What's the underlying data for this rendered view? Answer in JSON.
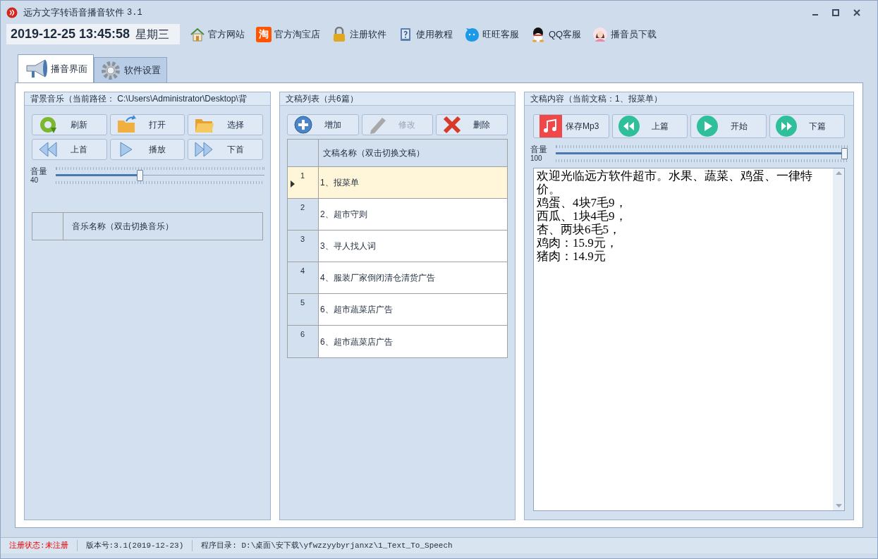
{
  "window": {
    "title": "远方文字转语音播音软件",
    "version": "3.1"
  },
  "toolbar": {
    "datetime": "2019-12-25 13:45:58",
    "weekday": "星期三",
    "links": [
      {
        "kind": "home",
        "label": "官方网站"
      },
      {
        "kind": "taobao",
        "label": "官方淘宝店",
        "icon_text": "淘"
      },
      {
        "kind": "lock",
        "label": "注册软件"
      },
      {
        "kind": "help",
        "label": "使用教程"
      },
      {
        "kind": "wangwang",
        "label": "旺旺客服"
      },
      {
        "kind": "qq",
        "label": "QQ客服"
      },
      {
        "kind": "person",
        "label": "播音员下载"
      }
    ]
  },
  "tabs": [
    {
      "kind": "speaker",
      "label": "播音界面",
      "selected": true
    },
    {
      "kind": "gear",
      "label": "软件设置",
      "selected": false
    }
  ],
  "music_panel": {
    "title": "背景音乐（当前路径： C:\\Users\\Administrator\\Desktop\\背",
    "buttons": [
      {
        "kind": "refresh",
        "label": "刷新"
      },
      {
        "kind": "open",
        "label": "打开"
      },
      {
        "kind": "folder",
        "label": "选择"
      },
      {
        "kind": "prev",
        "label": "上首"
      },
      {
        "kind": "play",
        "label": "播放"
      },
      {
        "kind": "next",
        "label": "下首"
      }
    ],
    "volume": {
      "label": "音量",
      "reading": "40",
      "level": 0.4
    },
    "table": {
      "columns": [
        "音乐名称（双击切换音乐）"
      ]
    }
  },
  "scripts_panel": {
    "title": "文稿列表（共6篇）",
    "buttons": [
      {
        "kind": "add",
        "label": "增加",
        "disabled": false
      },
      {
        "kind": "edit",
        "label": "修改",
        "disabled": true
      },
      {
        "kind": "delete",
        "label": "删除",
        "disabled": false
      }
    ],
    "table": {
      "columns": [
        "文稿名称（双击切换文稿）"
      ],
      "rows": [
        {
          "number": "1",
          "name": "1、报菜单",
          "selected": true
        },
        {
          "number": "2",
          "name": "2、超市守则",
          "selected": false
        },
        {
          "number": "3",
          "name": "3、寻人找人词",
          "selected": false
        },
        {
          "number": "4",
          "name": "4、服装厂家倒闭清仓清货广告",
          "selected": false
        },
        {
          "number": "5",
          "name": "6、超市蔬菜店广告",
          "selected": false
        },
        {
          "number": "6",
          "name": "6、超市蔬菜店广告",
          "selected": false
        }
      ]
    }
  },
  "content_panel": {
    "title": "文稿内容（当前文稿：1、报菜单）",
    "buttons": [
      {
        "kind": "mp3",
        "label": "保存Mp3"
      },
      {
        "kind": "prev",
        "label": "上篇"
      },
      {
        "kind": "play",
        "label": "开始"
      },
      {
        "kind": "next",
        "label": "下篇"
      }
    ],
    "volume": {
      "label": "音量",
      "reading": "100",
      "level": 1.0
    },
    "text_lines": [
      "欢迎光临远方软件超市。水果、蔬菜、鸡蛋、一律特价。",
      "鸡蛋、4块7毛9，",
      "西瓜、1块4毛9，",
      "杏、两块6毛5，",
      "鸡肉：15.9元，",
      "猪肉：14.9元"
    ]
  },
  "status_bar": {
    "registration": "注册状态:未注册",
    "version": "版本号:3.1(2019-12-23)",
    "directory": "程序目录: D:\\桌面\\安下载\\yfwzzyybyrjanxz\\1_Text_To_Speech"
  }
}
